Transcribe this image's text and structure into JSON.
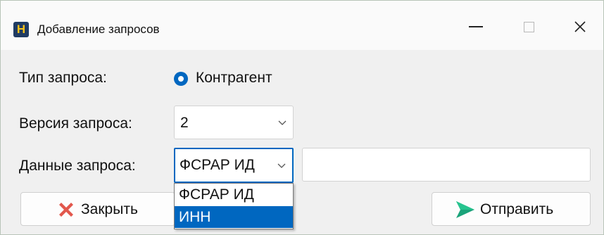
{
  "window": {
    "title": "Добавление запросов",
    "app_icon_letter": "H"
  },
  "form": {
    "type_label": "Тип запроса:",
    "type_option": "Контрагент",
    "version_label": "Версия запроса:",
    "version_value": "2",
    "data_label": "Данные запроса:",
    "data_value": "ФСРАР ИД",
    "data_input_value": ""
  },
  "dropdown": {
    "options": [
      "ФСРАР ИД",
      "ИНН"
    ],
    "highlighted": "ИНН"
  },
  "buttons": {
    "close_label": "Закрыть",
    "send_label": "Отправить"
  },
  "colors": {
    "accent": "#0067c0",
    "close_icon": "#e2574c",
    "send_icon": "#1aa37a"
  }
}
